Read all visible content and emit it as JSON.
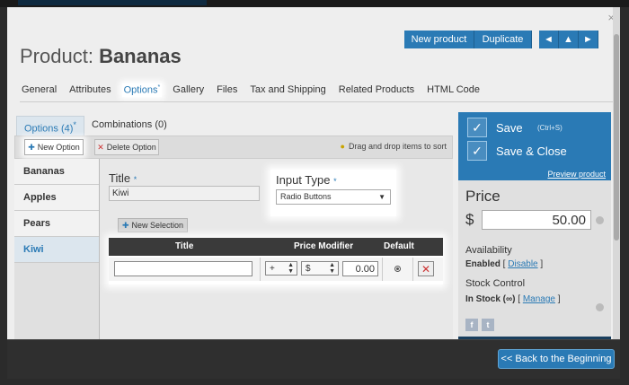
{
  "header": {
    "title_prefix": "Product:",
    "title_name": "Bananas",
    "close": "×"
  },
  "top_buttons": {
    "new_product": "New product",
    "duplicate": "Duplicate",
    "nav_first": "◄",
    "nav_up": "▲",
    "nav_next": "►"
  },
  "tabs": [
    {
      "label": "General"
    },
    {
      "label": "Attributes"
    },
    {
      "label": "Options",
      "mark": "*"
    },
    {
      "label": "Gallery"
    },
    {
      "label": "Files"
    },
    {
      "label": "Tax and Shipping"
    },
    {
      "label": "Related Products"
    },
    {
      "label": "HTML Code"
    }
  ],
  "subtabs": {
    "options": "Options (4)",
    "options_mark": "*",
    "combinations": "Combinations (0)"
  },
  "toolbar": {
    "new_option": "New Option",
    "delete_option": "Delete Option",
    "drag_hint": "Drag and drop items to sort"
  },
  "options_list": [
    {
      "label": "Bananas"
    },
    {
      "label": "Apples"
    },
    {
      "label": "Pears"
    },
    {
      "label": "Kiwi"
    }
  ],
  "editor": {
    "title_label": "Title",
    "required_mark": "*",
    "title_value": "Kiwi",
    "input_type_label": "Input Type",
    "input_type_value": "Radio Buttons",
    "new_selection": "New Selection"
  },
  "selections_table": {
    "headers": [
      "Title",
      "Price Modifier",
      "Default"
    ],
    "row": {
      "title": "",
      "operator": "+",
      "unit": "$",
      "price": "0.00"
    }
  },
  "right_panel": {
    "save": "Save",
    "save_shortcut": "(Ctrl+S)",
    "save_close": "Save & Close",
    "preview": "Preview product",
    "price_heading": "Price",
    "currency": "$",
    "price_value": "50.00",
    "availability_label": "Availability",
    "availability_value": "Enabled",
    "availability_action": "Disable",
    "stock_label": "Stock Control",
    "stock_value": "In Stock (∞)",
    "stock_action": "Manage"
  },
  "footer": {
    "back": "<< Back to the Beginning"
  }
}
